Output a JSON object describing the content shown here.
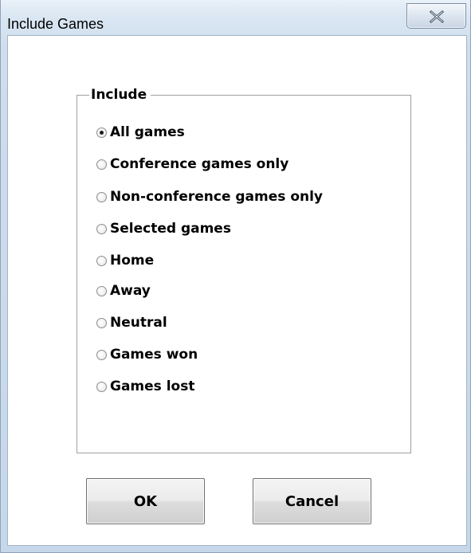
{
  "window": {
    "title": "Include Games"
  },
  "group": {
    "legend": "Include",
    "options": [
      {
        "label": "All games",
        "checked": true
      },
      {
        "label": "Conference games only",
        "checked": false
      },
      {
        "label": "Non-conference games only",
        "checked": false
      },
      {
        "label": "Selected games",
        "checked": false
      },
      {
        "label": "Home",
        "checked": false
      },
      {
        "label": "Away",
        "checked": false
      },
      {
        "label": "Neutral",
        "checked": false
      },
      {
        "label": "Games won",
        "checked": false
      },
      {
        "label": "Games lost",
        "checked": false
      }
    ]
  },
  "buttons": {
    "ok_label": "OK",
    "cancel_label": "Cancel"
  },
  "icons": {
    "close": "close-icon",
    "radio": "radio-button-icon"
  }
}
